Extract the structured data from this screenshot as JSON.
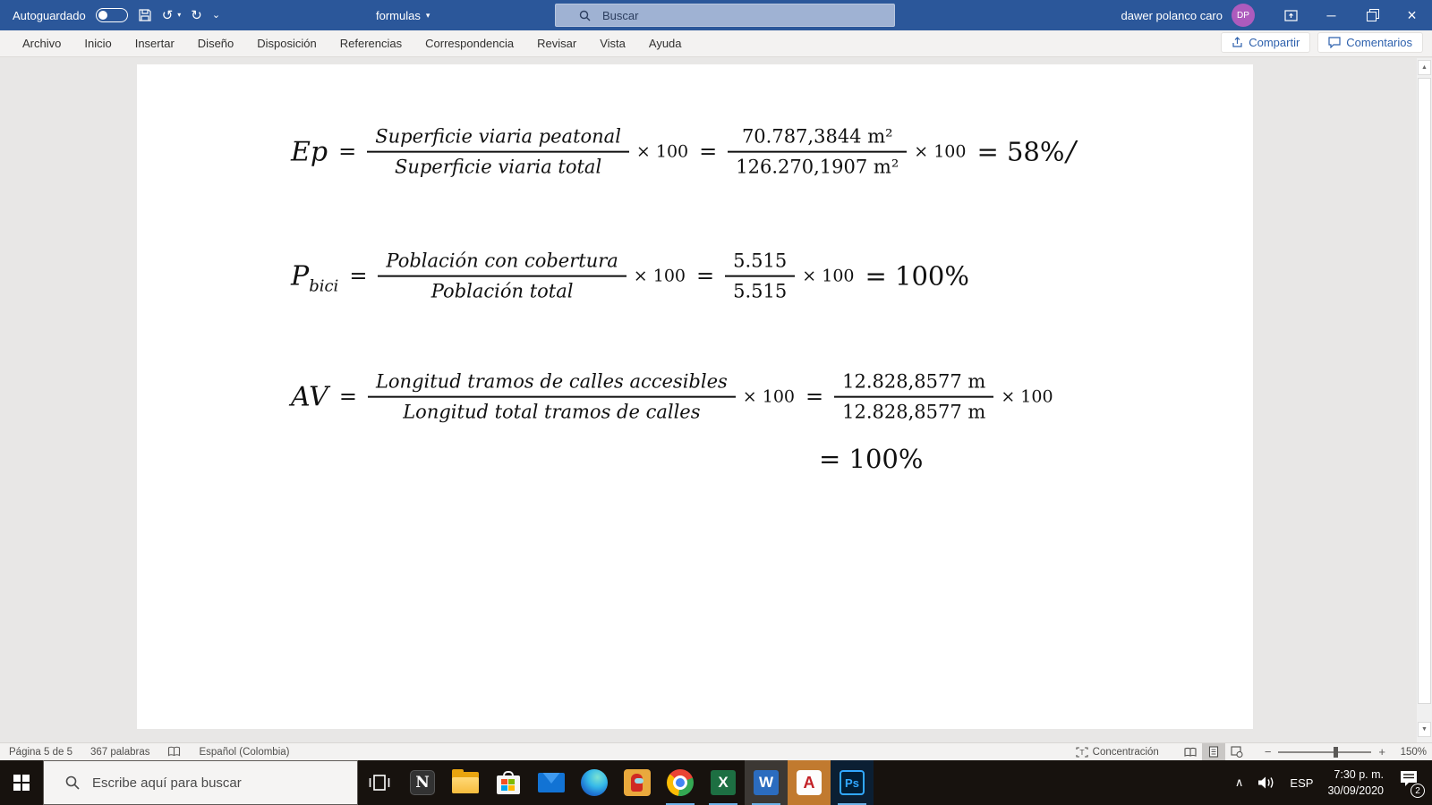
{
  "colors": {
    "accent": "#2b579a",
    "taskbar_bg": "#17120e",
    "avatar_bg": "#ad5bbd"
  },
  "titlebar": {
    "autosave_label": "Autoguardado",
    "doc_title": "formulas",
    "search_placeholder": "Buscar",
    "user_name": "dawer polanco caro",
    "user_initials": "DP"
  },
  "icons": {
    "dropdown": "▾",
    "undo": "↺",
    "redo": "↻",
    "qat_chevron": "⌄",
    "minimize": "─",
    "close": "×",
    "scroll_up": "▲",
    "scroll_down": "▼",
    "tray_chevron": "∧",
    "zoom_minus": "−",
    "zoom_plus": "+"
  },
  "ribbon": {
    "tabs": [
      "Archivo",
      "Inicio",
      "Insertar",
      "Diseño",
      "Disposición",
      "Referencias",
      "Correspondencia",
      "Revisar",
      "Vista",
      "Ayuda"
    ],
    "share": "Compartir",
    "comments": "Comentarios"
  },
  "doc": {
    "formulas": [
      {
        "lhs": "Ep",
        "lhs_sub": "",
        "eq1": "=",
        "num_text": "Superficie viaria peatonal",
        "den_text": "Superficie viaria total",
        "times1": "× 100",
        "eq2": "=",
        "num_val": "70.787,3844 m²",
        "den_val": "126.270,1907 m²",
        "times2": "× 100",
        "result": "= 58%",
        "cursor": "/"
      },
      {
        "lhs": "P",
        "lhs_sub": "bici",
        "eq1": "=",
        "num_text": "Población con cobertura",
        "den_text": "Población total",
        "times1": "× 100",
        "eq2": "=",
        "num_val": "5.515",
        "den_val": "5.515",
        "times2": "× 100",
        "result": "= 100%",
        "cursor": ""
      },
      {
        "lhs": "AV",
        "lhs_sub": "",
        "eq1": "=",
        "num_text": "Longitud tramos de calles accesibles",
        "den_text": "Longitud total tramos de calles",
        "times1": "× 100",
        "eq2": "=",
        "num_val": "12.828,8577 m",
        "den_val": "12.828,8577 m",
        "times2": "× 100",
        "result": "",
        "cursor": ""
      }
    ],
    "continuation": "= 100%"
  },
  "statusbar": {
    "page": "Página 5 de 5",
    "words": "367 palabras",
    "language": "Español (Colombia)",
    "focus": "Concentración",
    "zoom": "150%"
  },
  "taskbar": {
    "search_placeholder": "Escribe aquí para buscar",
    "glyphs": {
      "notion": "N",
      "excel": "X",
      "word": "W",
      "autocad": "A",
      "photoshop": "Ps"
    },
    "tray": {
      "lang": "ESP",
      "time": "7:30 p. m.",
      "date": "30/09/2020",
      "badge": "2"
    }
  }
}
